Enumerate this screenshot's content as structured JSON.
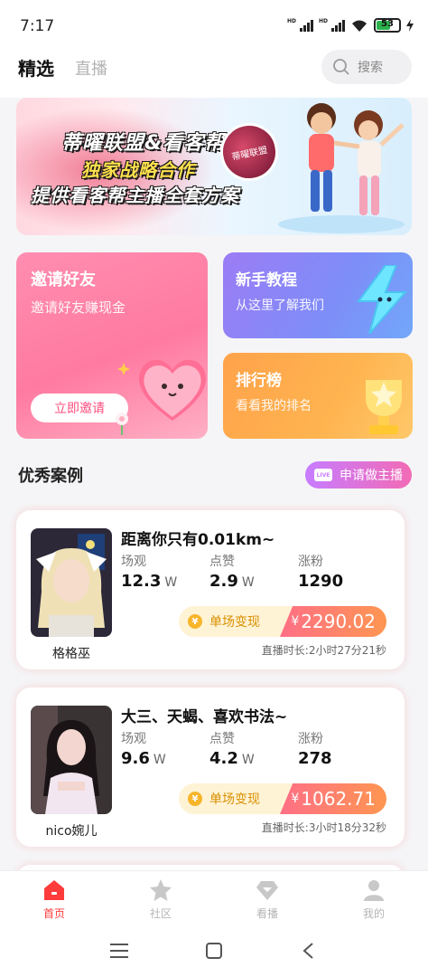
{
  "status_bar": {
    "time": "7:17",
    "battery": "53",
    "signal_label": "HD"
  },
  "top_tabs": {
    "active": "精选",
    "inactive": "直播"
  },
  "search": {
    "placeholder": "搜索"
  },
  "banner": {
    "line1": "蒂曜联盟&看客帮",
    "line2": "独家战略合作",
    "line3": "提供看客帮主播全套方案",
    "badge": "蒂曜联盟"
  },
  "cards": {
    "invite": {
      "title": "邀请好友",
      "subtitle": "邀请好友赚现金",
      "button": "立即邀请"
    },
    "tutorial": {
      "title": "新手教程",
      "subtitle": "从这里了解我们"
    },
    "rank": {
      "title": "排行榜",
      "subtitle": "看看我的排名"
    }
  },
  "section": {
    "title": "优秀案例",
    "apply_button": "申请做主播",
    "apply_icon_text": "LIVE"
  },
  "stat_labels": {
    "views": "场观",
    "likes": "点赞",
    "fans": "涨粉"
  },
  "cases": [
    {
      "name": "格格巫",
      "title": "距离你只有0.01km~",
      "views": "12.3",
      "views_unit": "W",
      "likes": "2.9",
      "likes_unit": "W",
      "fans": "1290",
      "earn_label": "单场变现",
      "currency": "¥",
      "amount": "2290.02",
      "duration": "直播时长:2小时27分21秒"
    },
    {
      "name": "nico婉儿",
      "title": "大三、天蝎、喜欢书法~",
      "views": "9.6",
      "views_unit": "W",
      "likes": "4.2",
      "likes_unit": "W",
      "fans": "278",
      "earn_label": "单场变现",
      "currency": "¥",
      "amount": "1062.71",
      "duration": "直播时长:3小时18分32秒"
    }
  ],
  "bottom_nav": [
    {
      "label": "首页",
      "icon": "home-icon",
      "active": true
    },
    {
      "label": "社区",
      "icon": "star-icon",
      "active": false
    },
    {
      "label": "看播",
      "icon": "diamond-icon",
      "active": false
    },
    {
      "label": "我的",
      "icon": "user-icon",
      "active": false
    }
  ],
  "colors": {
    "accent": "#ff3b3b",
    "invite_card": "#ff7aa0",
    "tutorial_card": "#7d8ef8",
    "rank_card": "#ffa24a"
  }
}
